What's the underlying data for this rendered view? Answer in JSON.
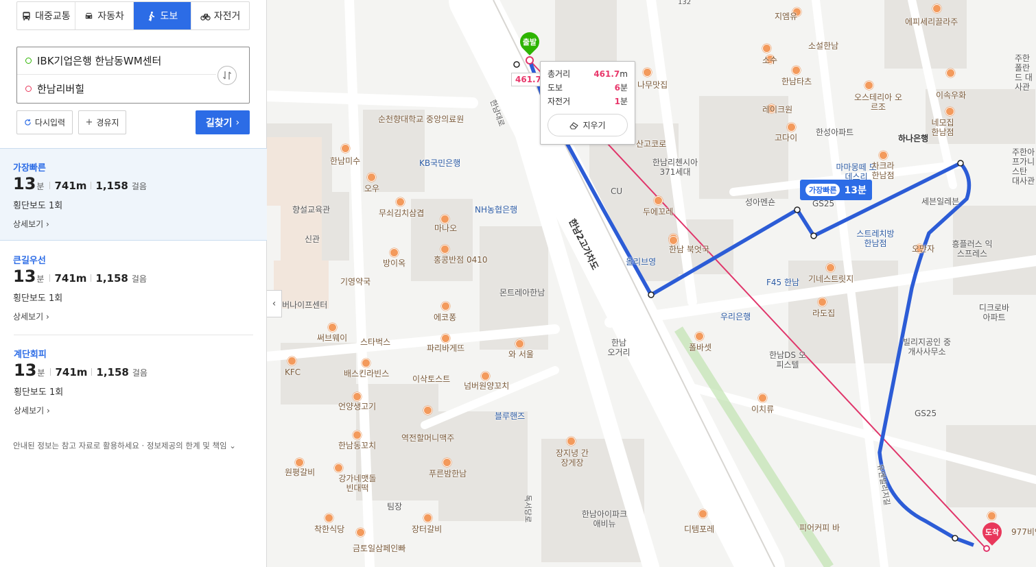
{
  "modes": [
    {
      "label": "대중교통",
      "icon": "bus-icon"
    },
    {
      "label": "자동차",
      "icon": "car-icon"
    },
    {
      "label": "도보",
      "icon": "walk-icon"
    },
    {
      "label": "자전거",
      "icon": "bicycle-icon"
    }
  ],
  "route": {
    "start": "IBK기업은행 한남동WM센터",
    "end": "한남리버힐"
  },
  "buttons": {
    "reset": "다시입력",
    "via": "경유지",
    "find": "길찾기"
  },
  "results": [
    {
      "title": "가장빠른",
      "minutes": "13",
      "min_unit": "분",
      "distance": "741m",
      "steps": "1,158",
      "steps_unit": "걸음",
      "crossings": "횡단보도 1회",
      "detail": "상세보기"
    },
    {
      "title": "큰길우선",
      "minutes": "13",
      "min_unit": "분",
      "distance": "741m",
      "steps": "1,158",
      "steps_unit": "걸음",
      "crossings": "횡단보도 1회",
      "detail": "상세보기"
    },
    {
      "title": "계단회피",
      "minutes": "13",
      "min_unit": "분",
      "distance": "741m",
      "steps": "1,158",
      "steps_unit": "걸음",
      "crossings": "횡단보도 1회",
      "detail": "상세보기"
    }
  ],
  "notice": "안내된 정보는 참고 자료로 활용하세요 · 정보제공의 한계 및 책임",
  "measure": {
    "total_label": "총거리",
    "total_value": "461.7",
    "total_unit": "m",
    "walk_label": "도보",
    "walk_value": "6",
    "walk_unit": "분",
    "bike_label": "자전거",
    "bike_value": "1",
    "bike_unit": "분",
    "erase": "지우기",
    "tag": "461.7m"
  },
  "route_tag": {
    "chip": "가장빠른",
    "time": "13분"
  },
  "pins": {
    "start": "출발",
    "end": "도착"
  },
  "map_labels": [
    "순천향대학교 중앙의료원",
    "KB국민은행",
    "NH농협은행",
    "한남미수",
    "오우",
    "무쇠김치삼겹",
    "마나오",
    "향설교육관",
    "신관",
    "방이옥",
    "홍콩반점 0410",
    "몬트레아한남",
    "기영약국",
    "사이버나이프센터",
    "에코퐁",
    "써브웨이",
    "스타벅스",
    "파리바게뜨",
    "와 서울",
    "KFC",
    "배스킨라빈스",
    "이삭토스트",
    "넘버원양꼬치",
    "언양생고기",
    "블루핸즈",
    "역전할머니맥주",
    "한남동꼬치",
    "원평갈비",
    "강가네맷돌 빈대떡",
    "푸른밤한남",
    "팀장",
    "착한식당",
    "장터갈비",
    "금토일삼페인빠",
    "장지녕 간장게장",
    "한남아이파크 애비뉴",
    "한남 오거리",
    "한남대로",
    "한남2고가차도",
    "지엠유",
    "소설한남",
    "소수",
    "한남타츠",
    "레이크원",
    "한성아파트",
    "오스테리아 오르조",
    "에피세리끌라주",
    "하나은행",
    "이속우화",
    "네모집 한남점",
    "주한폴란드 대사관",
    "고다이",
    "마마몽떼 모데스리",
    "차크라 한남점",
    "주한아프가니스탄 대사관",
    "나무맛집",
    "산고코로",
    "한남리첸시아 371세대",
    "CU",
    "두에꼬레",
    "성아멘숀",
    "GS25",
    "세븐일레븐",
    "스트레치방 한남점",
    "오만자",
    "흥플러스 익스프레스",
    "올리브영",
    "한남 북엇국",
    "F45 한남",
    "기네스트릿지",
    "라도집",
    "우리은행",
    "폴바셋",
    "한남DS 오피스텔",
    "빌리지공인 중개사사무소",
    "디크로바 아파트",
    "GS25",
    "이치류",
    "디템포레",
    "피어커피 바",
    "977비앤",
    "유엔빌리지길",
    "독서당로",
    "132"
  ]
}
